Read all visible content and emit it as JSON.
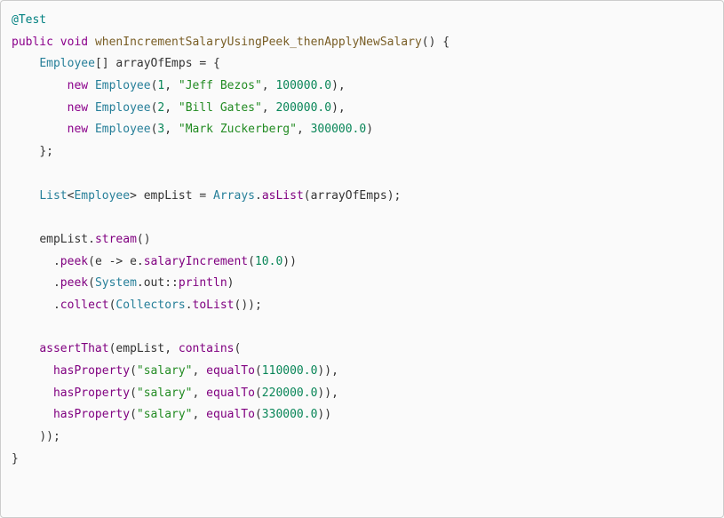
{
  "code": {
    "annotation": "@Test",
    "keywords": {
      "public": "public",
      "void": "void",
      "new": "new"
    },
    "methodDecl": "whenIncrementSalaryUsingPeek_thenApplyNewSalary",
    "types": {
      "employee": "Employee",
      "list": "List",
      "arrays": "Arrays",
      "system": "System",
      "collectors": "Collectors"
    },
    "vars": {
      "arrayOfEmps": "arrayOfEmps",
      "empList": "empList",
      "e": "e",
      "out": "out"
    },
    "methods": {
      "asList": "asList",
      "stream": "stream",
      "peek": "peek",
      "salaryIncrement": "salaryIncrement",
      "println": "println",
      "collect": "collect",
      "toList": "toList",
      "assertThat": "assertThat",
      "contains": "contains",
      "hasProperty": "hasProperty",
      "equalTo": "equalTo"
    },
    "strings": {
      "jeff": "\"Jeff Bezos\"",
      "bill": "\"Bill Gates\"",
      "mark": "\"Mark Zuckerberg\"",
      "salary": "\"salary\""
    },
    "numbers": {
      "n1": "1",
      "n2": "2",
      "n3": "3",
      "s1": "100000.0",
      "s2": "200000.0",
      "s3": "300000.0",
      "ten": "10.0",
      "r1": "110000.0",
      "r2": "220000.0",
      "r3": "330000.0"
    },
    "punct": {
      "paren_open": "(",
      "paren_close": ")",
      "brace_open": "{",
      "brace_close": "}",
      "bracket_open": "[",
      "bracket_close": "]",
      "angle_open": "<",
      "angle_close": ">",
      "comma": ",",
      "semi": ";",
      "dot": ".",
      "eq": " = ",
      "arrow": " -> ",
      "dblcolon": "::",
      "empty_parens": "()",
      "space": " "
    }
  }
}
